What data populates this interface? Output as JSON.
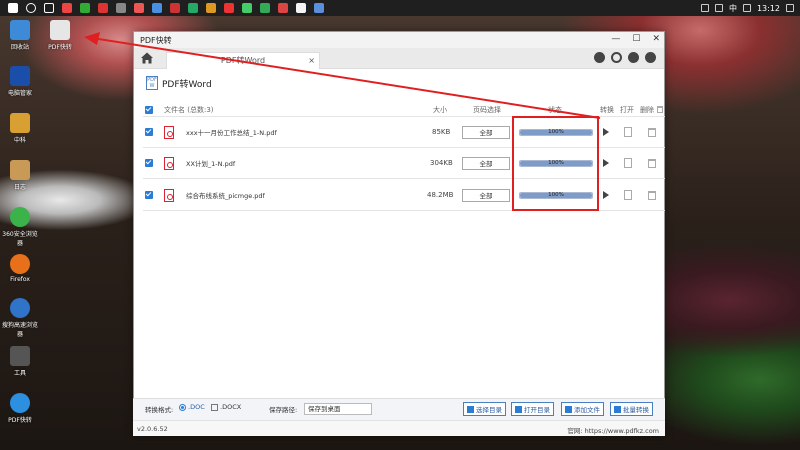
{
  "taskbar": {
    "clock": "13:12",
    "ime": "中"
  },
  "desktop": [
    {
      "label": "回收站",
      "color": "#3c8ad8"
    },
    {
      "label": "PDF快转",
      "color": "#e6e6e6"
    },
    {
      "label": "电脑管家",
      "color": "#1a4ea8"
    },
    {
      "label": "中科",
      "color": "#d8a033"
    },
    {
      "label": "日志",
      "color": "#c89a55"
    },
    {
      "label": "360安全浏览器",
      "color": "#3bb34a"
    },
    {
      "label": "Firefox",
      "color": "#e8701a"
    },
    {
      "label": "搜狗高速浏览器",
      "color": "#2f74c8"
    },
    {
      "label": "工具",
      "color": "#555555"
    },
    {
      "label": "PDF快转",
      "color": "#2c8fe0"
    }
  ],
  "window": {
    "title": "PDF快转",
    "tab_label": "PDF转Word",
    "tab_close": "×",
    "section_title": "PDF转Word"
  },
  "table": {
    "headers": {
      "name": "文件名 (总数:3)",
      "size": "大小",
      "page": "页码选择",
      "status": "状态",
      "convert": "转换",
      "open": "打开",
      "delete": "删除"
    },
    "rows": [
      {
        "name": "xxx十一月份工作总结_1-N.pdf",
        "size": "85KB",
        "page": "全部",
        "progress": 100,
        "progress_label": "100%"
      },
      {
        "name": "XX计划_1-N.pdf",
        "size": "304KB",
        "page": "全部",
        "progress": 100,
        "progress_label": "100%"
      },
      {
        "name": "综合布线系统_picmge.pdf",
        "size": "48.2MB",
        "page": "全部",
        "progress": 100,
        "progress_label": "100%"
      }
    ]
  },
  "bottom": {
    "format_label": "转换格式:",
    "opt_doc": ".DOC",
    "opt_docx": ".DOCX",
    "path_label": "保存路径:",
    "path_value": "保存到桌面",
    "btn_select": "选择目录",
    "btn_open": "打开目录",
    "btn_add": "添加文件",
    "btn_batch": "批量转换"
  },
  "footer": {
    "version": "v2.0.6.52",
    "site_label": "官网: https://www.pdfkz.com"
  },
  "colors": {
    "accent": "#2b7cd3",
    "highlight": "#e02020",
    "progress_fill": "#7f9cc9"
  }
}
